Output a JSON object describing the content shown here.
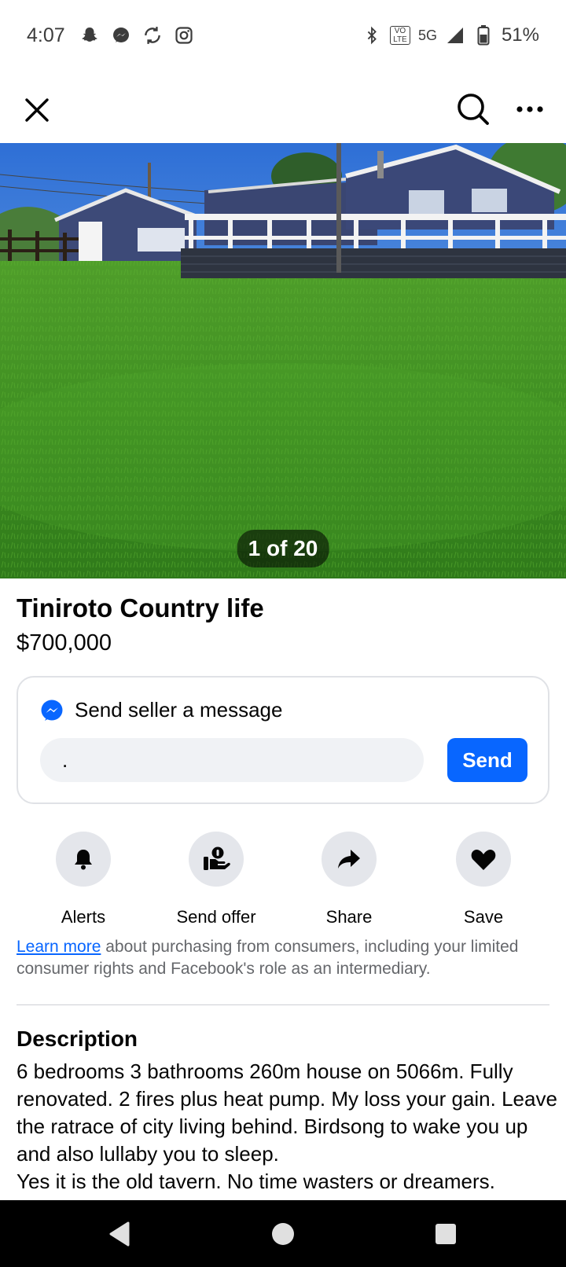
{
  "status_bar": {
    "time": "4:07",
    "network_badge": "VO LTE",
    "network_type": "5G",
    "battery": "51%",
    "left_icons": [
      "snapchat-icon",
      "messenger-icon",
      "sync-icon",
      "instagram-icon"
    ],
    "right_icons": [
      "bluetooth-icon",
      "volte-icon",
      "signal-icon",
      "battery-icon"
    ]
  },
  "app_bar": {
    "icons": [
      "close-icon",
      "search-icon",
      "more-icon"
    ]
  },
  "hero": {
    "counter": "1 of 20"
  },
  "listing": {
    "title": "Tiniroto Country life",
    "price": "$700,000"
  },
  "message": {
    "header": "Send seller a message",
    "input_value": ".",
    "send_label": "Send"
  },
  "actions": [
    {
      "label": "Alerts",
      "icon": "bell-icon"
    },
    {
      "label": "Send offer",
      "icon": "offer-icon"
    },
    {
      "label": "Share",
      "icon": "share-icon"
    },
    {
      "label": "Save",
      "icon": "heart-icon"
    }
  ],
  "disclaimer": {
    "link": "Learn more",
    "text": " about purchasing from consumers, including your limited consumer rights and Facebook's role as an intermediary."
  },
  "description": {
    "heading": "Description",
    "body": "6 bedrooms 3 bathrooms 260m house on 5066m. Fully renovated. 2 fires plus heat pump. My loss your gain. Leave the ratrace of city living behind. Birdsong to wake you up and also lullaby you to sleep.\nYes it is the old tavern. No time wasters or dreamers."
  },
  "colors": {
    "accent": "#0866ff",
    "secondary_bg": "#e4e6eb",
    "muted_text": "#65676b"
  }
}
